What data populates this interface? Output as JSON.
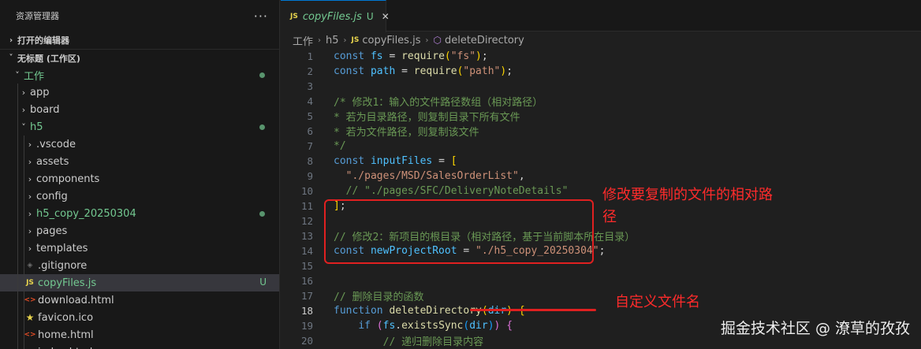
{
  "explorer": {
    "title": "资源管理器",
    "more": "···",
    "open_editors": "打开的编辑器",
    "workspace": "无标题 (工作区)",
    "items": [
      {
        "label": "工作",
        "chev": "˅",
        "depth": 0,
        "icon": "",
        "state": "mod",
        "dot": true
      },
      {
        "label": "app",
        "chev": "›",
        "depth": 1,
        "icon": "",
        "state": "",
        "dot": false
      },
      {
        "label": "board",
        "chev": "›",
        "depth": 1,
        "icon": "",
        "state": "",
        "dot": false
      },
      {
        "label": "h5",
        "chev": "˅",
        "depth": 1,
        "icon": "",
        "state": "mod",
        "dot": true
      },
      {
        "label": ".vscode",
        "chev": "›",
        "depth": 2,
        "icon": "",
        "state": "",
        "dot": false
      },
      {
        "label": "assets",
        "chev": "›",
        "depth": 2,
        "icon": "",
        "state": "",
        "dot": false
      },
      {
        "label": "components",
        "chev": "›",
        "depth": 2,
        "icon": "",
        "state": "",
        "dot": false
      },
      {
        "label": "config",
        "chev": "›",
        "depth": 2,
        "icon": "",
        "state": "",
        "dot": false
      },
      {
        "label": "h5_copy_20250304",
        "chev": "›",
        "depth": 2,
        "icon": "",
        "state": "new",
        "dot": true
      },
      {
        "label": "pages",
        "chev": "›",
        "depth": 2,
        "icon": "",
        "state": "",
        "dot": false
      },
      {
        "label": "templates",
        "chev": "›",
        "depth": 2,
        "icon": "",
        "state": "",
        "dot": false
      },
      {
        "label": ".gitignore",
        "chev": "",
        "depth": 2,
        "icon": "git",
        "state": "",
        "dot": false
      },
      {
        "label": "copyFiles.js",
        "chev": "",
        "depth": 2,
        "icon": "js",
        "state": "new",
        "dot": false,
        "badge": "U",
        "selected": true
      },
      {
        "label": "download.html",
        "chev": "",
        "depth": 2,
        "icon": "html",
        "state": "",
        "dot": false
      },
      {
        "label": "favicon.ico",
        "chev": "",
        "depth": 2,
        "icon": "star",
        "state": "",
        "dot": false
      },
      {
        "label": "home.html",
        "chev": "",
        "depth": 2,
        "icon": "html",
        "state": "",
        "dot": false
      },
      {
        "label": "index.html",
        "chev": "",
        "depth": 2,
        "icon": "html",
        "state": "",
        "dot": false
      }
    ]
  },
  "tab": {
    "badge": "JS",
    "name": "copyFiles.js",
    "status": "U",
    "close": "✕"
  },
  "breadcrumb": {
    "items": [
      "工作",
      "h5",
      "copyFiles.js",
      "deleteDirectory"
    ],
    "js_badge": "JS"
  },
  "code": {
    "active_line": 18,
    "lines": [
      [
        [
          "kw",
          "const "
        ],
        [
          "vr",
          "fs"
        ],
        [
          "op",
          " = "
        ],
        [
          "fn",
          "require"
        ],
        [
          "br1",
          "("
        ],
        [
          "st",
          "\"fs\""
        ],
        [
          "br1",
          ")"
        ],
        [
          "pn",
          ";"
        ]
      ],
      [
        [
          "kw",
          "const "
        ],
        [
          "vr",
          "path"
        ],
        [
          "op",
          " = "
        ],
        [
          "fn",
          "require"
        ],
        [
          "br1",
          "("
        ],
        [
          "st",
          "\"path\""
        ],
        [
          "br1",
          ")"
        ],
        [
          "pn",
          ";"
        ]
      ],
      [],
      [
        [
          "cm",
          "/* 修改1：输入的文件路径数组（相对路径）"
        ]
      ],
      [
        [
          "cm",
          "* 若为目录路径，则复制目录下所有文件"
        ]
      ],
      [
        [
          "cm",
          "* 若为文件路径，则复制该文件"
        ]
      ],
      [
        [
          "cm",
          "*/"
        ]
      ],
      [
        [
          "kw",
          "const "
        ],
        [
          "vr",
          "inputFiles"
        ],
        [
          "op",
          " = "
        ],
        [
          "br1",
          "["
        ]
      ],
      [
        [
          "pn",
          "  "
        ],
        [
          "st",
          "\"./pages/MSD/SalesOrderList\""
        ],
        [
          "pn",
          ","
        ]
      ],
      [
        [
          "cm",
          "  // \"./pages/SFC/DeliveryNoteDetails\""
        ]
      ],
      [
        [
          "br1",
          "]"
        ],
        [
          "pn",
          ";"
        ]
      ],
      [],
      [
        [
          "cm",
          "// 修改2：新项目的根目录（相对路径，基于当前脚本所在目录）"
        ]
      ],
      [
        [
          "kw",
          "const "
        ],
        [
          "vr",
          "newProjectRoot"
        ],
        [
          "op",
          " = "
        ],
        [
          "st",
          "\"./h5_copy_20250304\""
        ],
        [
          "pn",
          ";"
        ]
      ],
      [],
      [],
      [
        [
          "cm",
          "// 删除目录的函数"
        ]
      ],
      [
        [
          "kw",
          "function "
        ],
        [
          "fn",
          "deleteDirectory"
        ],
        [
          "br1",
          "("
        ],
        [
          "vr",
          "dir"
        ],
        [
          "br1",
          ")"
        ],
        [
          "pn",
          " "
        ],
        [
          "br1",
          "{"
        ]
      ],
      [
        [
          "pn",
          "    "
        ],
        [
          "kw",
          "if "
        ],
        [
          "br2",
          "("
        ],
        [
          "vr",
          "fs"
        ],
        [
          "pn",
          "."
        ],
        [
          "fn",
          "existsSync"
        ],
        [
          "br3",
          "("
        ],
        [
          "vr",
          "dir"
        ],
        [
          "br3",
          ")"
        ],
        [
          "br2",
          ")"
        ],
        [
          "pn",
          " "
        ],
        [
          "br2",
          "{"
        ]
      ],
      [
        [
          "pn",
          "        "
        ],
        [
          "cm",
          "// 递归删除目录内容"
        ]
      ]
    ]
  },
  "annotations": {
    "box_note": "修改要复制的文件的相对路径",
    "underline_note": "自定义文件名"
  },
  "watermark": "掘金技术社区 @ 潦草的孜孜"
}
